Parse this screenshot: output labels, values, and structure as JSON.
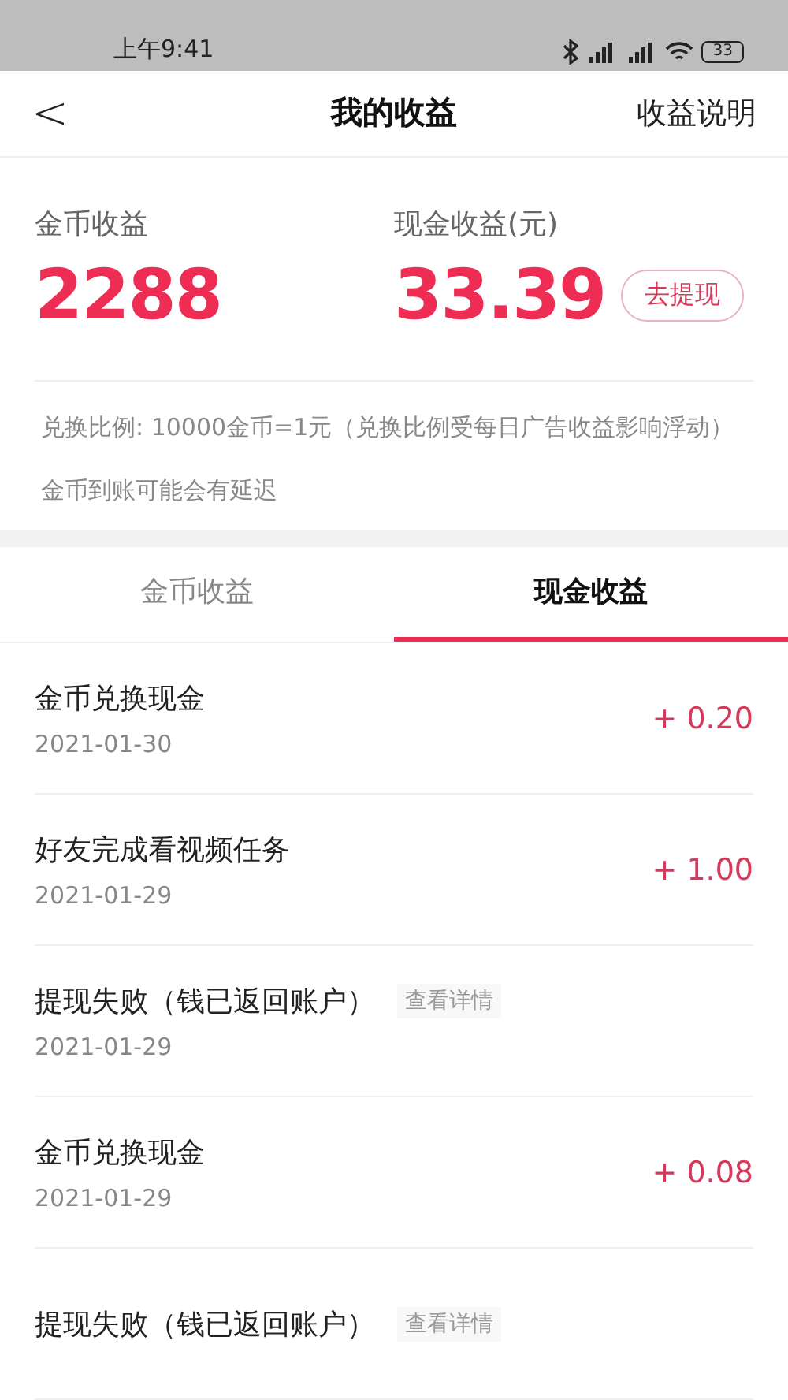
{
  "status_bar": {
    "time": "上午9:41",
    "battery": "33"
  },
  "header": {
    "back": "<",
    "title": "我的收益",
    "action": "收益说明"
  },
  "summary": {
    "coins": {
      "label": "金币收益",
      "value": "2288"
    },
    "cash": {
      "label": "现金收益(元)",
      "value": "33.39",
      "button": "去提现"
    },
    "notes": [
      "兑换比例: 10000金币=1元（兑换比例受每日广告收益影响浮动）",
      "金币到账可能会有延迟"
    ]
  },
  "tabs": [
    {
      "label": "金币收益",
      "selected": false
    },
    {
      "label": "现金收益",
      "selected": true
    }
  ],
  "records": [
    {
      "kind": "amount",
      "title": "金币兑换现金",
      "date": "2021-01-30",
      "amount": "+ 0.20"
    },
    {
      "kind": "amount",
      "title": "好友完成看视频任务",
      "date": "2021-01-29",
      "amount": "+ 1.00"
    },
    {
      "kind": "failed",
      "title": "提现失败（钱已返回账户）",
      "date": "2021-01-29",
      "link": "查看详情"
    },
    {
      "kind": "amount",
      "title": "金币兑换现金",
      "date": "2021-01-29",
      "amount": "+ 0.08"
    },
    {
      "kind": "failed",
      "title": "提现失败（钱已返回账户）",
      "link": "查看详情"
    }
  ]
}
